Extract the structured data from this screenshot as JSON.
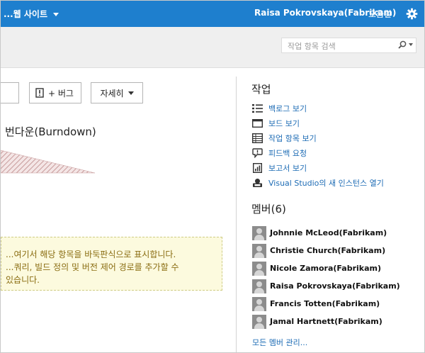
{
  "topbar": {
    "site_title": "...웹 사이트",
    "user_name": "Raisa Pokrovskaya(Fabrikam)",
    "help": "도움말",
    "settings_icon": "gear-icon"
  },
  "search": {
    "placeholder": "작업 항목 검색",
    "icon": "search-icon"
  },
  "toolbar": {
    "bug_label": "+ 버그",
    "detail_label": "자세히"
  },
  "burndown": {
    "title": "번다운(Burndown)"
  },
  "notice": {
    "lines": [
      "...여기서 해당 항목을 바둑판식으로 표시합니다.",
      "...쿼리, 빌드 정의 및 버전 제어 경로를 추가할 수",
      "있습니다."
    ]
  },
  "work": {
    "title": "작업",
    "links": [
      {
        "label": "백로그 보기",
        "icon": "backlog-list-icon"
      },
      {
        "label": "보드 보기",
        "icon": "board-icon"
      },
      {
        "label": "작업 항목 보기",
        "icon": "work-items-grid-icon"
      },
      {
        "label": "피드백 요청",
        "icon": "feedback-bubble-icon"
      },
      {
        "label": "보고서 보기",
        "icon": "report-icon"
      },
      {
        "label": "Visual Studio의 새 인스턴스 열기",
        "icon": "visual-studio-icon"
      }
    ]
  },
  "members": {
    "title": "멤버(6)",
    "list": [
      "Johnnie McLeod(Fabrikam)",
      "Christie Church(Fabrikam)",
      "Nicole Zamora(Fabrikam)",
      "Raisa Pokrovskaya(Fabrikam)",
      "Francis Totten(Fabrikam)",
      "Jamal Hartnett(Fabrikam)"
    ],
    "manage": "모든 멤버 관리..."
  },
  "colors": {
    "header": "#1e7fce",
    "link": "#1e6cb5",
    "notice_bg": "#fcfade",
    "notice_text": "#8a6d12",
    "chart_hatch": "#c79a9a"
  }
}
